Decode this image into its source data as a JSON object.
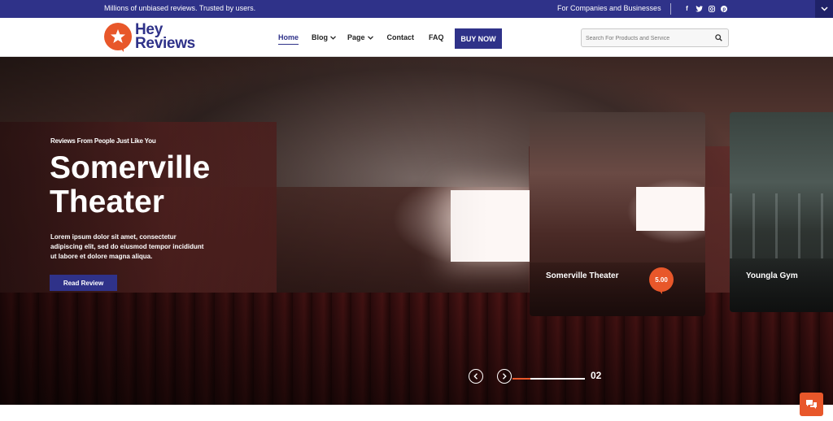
{
  "topbar": {
    "tagline": "Millions of unbiased reviews. Trusted by users.",
    "business_link": "For Companies and Businesses",
    "social": [
      "f",
      "t",
      "i",
      "p"
    ]
  },
  "logo": {
    "line1": "Hey",
    "line2": "Reviews"
  },
  "nav": {
    "items": [
      {
        "label": "Home",
        "active": true,
        "has_dropdown": false
      },
      {
        "label": "Blog",
        "active": false,
        "has_dropdown": true
      },
      {
        "label": "Page",
        "active": false,
        "has_dropdown": true
      },
      {
        "label": "Contact",
        "active": false,
        "has_dropdown": false
      },
      {
        "label": "FAQ",
        "active": false,
        "has_dropdown": false
      }
    ],
    "cta": "BUY NOW"
  },
  "search": {
    "placeholder": "Search For Products and Service",
    "value": ""
  },
  "hero": {
    "eyebrow": "Reviews From People Just Like You",
    "title": "Somerville Theater",
    "description": "Lorem ipsum dolor sit amet, consectetur adipiscing elit, sed do eiusmod tempor incididunt ut labore et dolore magna aliqua.",
    "button": "Read Review"
  },
  "cards": [
    {
      "name": "Somerville Theater",
      "rating": "5.00"
    },
    {
      "name": "Youngla Gym"
    }
  ],
  "slider": {
    "current": "02",
    "progress": 0.25
  },
  "colors": {
    "brand": "#2f3289",
    "accent": "#e8572a"
  },
  "icons": {
    "search": "search-icon",
    "chat": "chat-icon",
    "prev": "chevron-left-icon",
    "next": "chevron-right-icon"
  }
}
